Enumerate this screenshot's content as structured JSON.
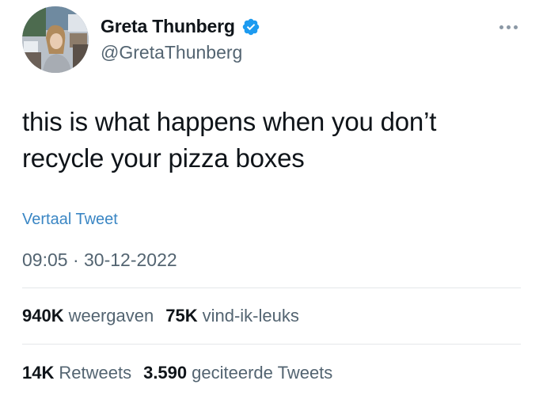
{
  "author": {
    "display_name": "Greta Thunberg",
    "handle": "@GretaThunberg",
    "verified_color": "#1d9bf0"
  },
  "tweet": {
    "text_line1": "this is what happens when you don’t",
    "text_line2": "recycle your pizza boxes",
    "translate_label": "Vertaal Tweet",
    "time": "09:05",
    "separator": " · ",
    "date": "30-12-2022"
  },
  "stats_row1": [
    {
      "value": "940K",
      "label": "weergaven"
    },
    {
      "value": "75K",
      "label": "vind-ik-leuks"
    }
  ],
  "stats_row2": [
    {
      "value": "14K",
      "label": "Retweets"
    },
    {
      "value": "3.590",
      "label": "geciteerde Tweets"
    }
  ],
  "icons": {
    "verified": "verified-badge-icon",
    "more": "more-options-icon"
  },
  "colors": {
    "text": "#0f1419",
    "secondary": "#536471",
    "link": "#3a86c4",
    "divider": "#e4e7ea"
  }
}
